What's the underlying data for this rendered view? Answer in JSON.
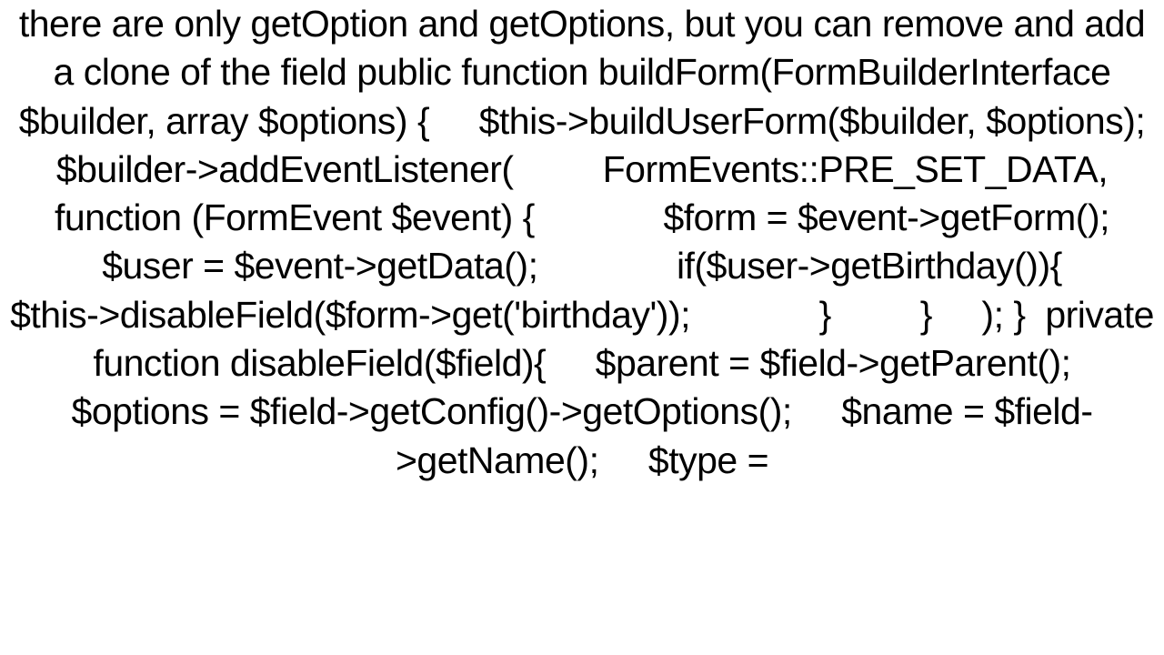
{
  "content": {
    "text": "there are only getOption and getOptions, but you can remove and add a clone of the field public function buildForm(FormBuilderInterface $builder, array $options) {     $this->buildUserForm($builder, $options);      $builder->addEventListener(         FormEvents::PRE_SET_DATA,         function (FormEvent $event) {             $form = $event->getForm();             $user = $event->getData();              if($user->getBirthday()){                 $this->disableField($form->get('birthday'));             }         }     ); }  private function disableField($field){     $parent = $field->getParent();     $options = $field->getConfig()->getOptions();     $name = $field->getName();     $type ="
  }
}
